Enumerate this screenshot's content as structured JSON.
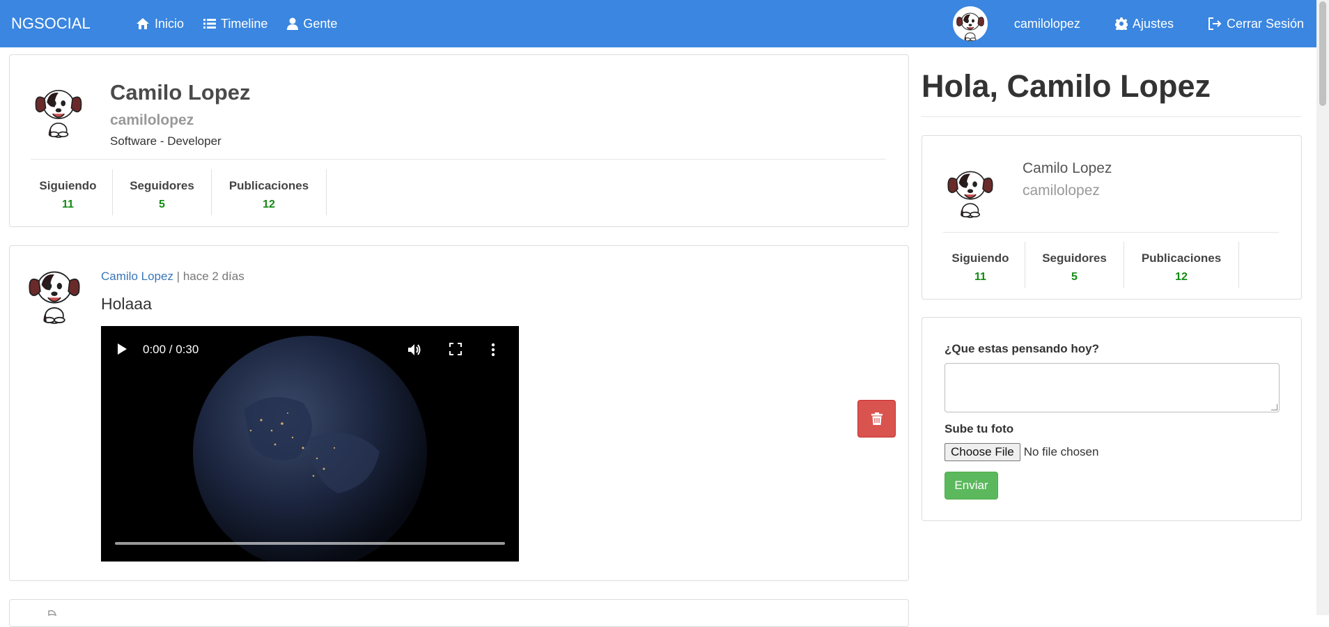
{
  "navbar": {
    "brand": "NGSOCIAL",
    "links": [
      {
        "label": "Inicio",
        "icon": "home-icon"
      },
      {
        "label": "Timeline",
        "icon": "list-icon"
      },
      {
        "label": "Gente",
        "icon": "user-icon"
      }
    ],
    "username": "camilolopez",
    "settings_label": "Ajustes",
    "logout_label": "Cerrar Sesión",
    "color": "#3a86e0"
  },
  "profile": {
    "name": "Camilo Lopez",
    "username": "camilolopez",
    "bio_part1": "Software",
    "bio_sep": " - ",
    "bio_part2": "Developer",
    "stats": [
      {
        "label": "Siguiendo",
        "value": "11"
      },
      {
        "label": "Seguidores",
        "value": "5"
      },
      {
        "label": "Publicaciones",
        "value": "12"
      }
    ]
  },
  "post": {
    "author": "Camilo Lopez",
    "separator": " | ",
    "time": "hace 2 días",
    "text": "Holaaa",
    "video_time": "0:00 / 0:30"
  },
  "sidebar": {
    "greeting": "Hola, Camilo Lopez",
    "name": "Camilo Lopez",
    "username": "camilolopez",
    "stats": [
      {
        "label": "Siguiendo",
        "value": "11"
      },
      {
        "label": "Seguidores",
        "value": "5"
      },
      {
        "label": "Publicaciones",
        "value": "12"
      }
    ]
  },
  "form": {
    "question_label": "¿Que estas pensando hoy?",
    "photo_label": "Sube tu foto",
    "file_button": "Choose File",
    "file_status": "No file chosen",
    "submit_label": "Enviar"
  },
  "colors": {
    "stat_value": "#138a13",
    "delete": "#d9534f",
    "submit": "#5cb85c"
  }
}
